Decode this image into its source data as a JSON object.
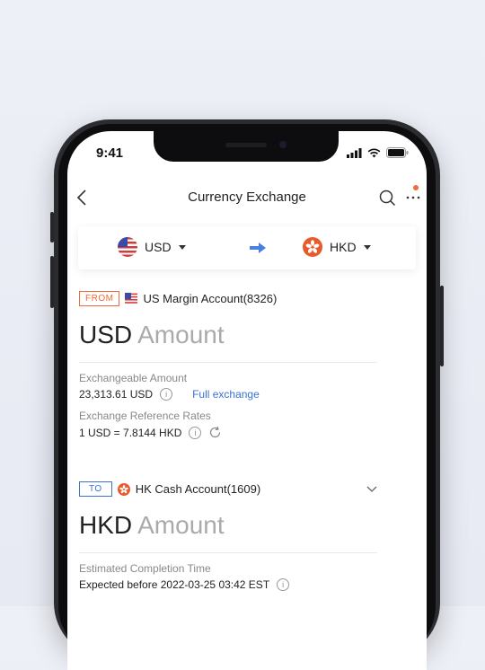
{
  "status": {
    "time": "9:41"
  },
  "nav": {
    "title": "Currency Exchange"
  },
  "pair": {
    "from_currency": "USD",
    "to_currency": "HKD"
  },
  "from": {
    "tag": "FROM",
    "account": "US Margin Account(8326)",
    "currency": "USD",
    "amount_placeholder": "Amount",
    "exchangeable_label": "Exchangeable Amount",
    "exchangeable_value": "23,313.61 USD",
    "full_exchange": "Full exchange",
    "rate_label": "Exchange Reference Rates",
    "rate_value": "1 USD = 7.8144 HKD"
  },
  "to": {
    "tag": "TO",
    "account": "HK Cash Account(1609)",
    "currency": "HKD",
    "amount_placeholder": "Amount",
    "completion_label": "Estimated Completion Time",
    "completion_value": "Expected before 2022-03-25 03:42 EST"
  },
  "colors": {
    "accent_orange": "#f06a3a",
    "link_blue": "#3a71d4",
    "arrow_blue": "#4a7fe0",
    "to_tag_blue": "#3a71d4"
  },
  "icons": [
    "back-icon",
    "search-icon",
    "more-icon",
    "us-flag-icon",
    "hk-flag-icon",
    "right-arrow-icon",
    "info-icon",
    "refresh-icon",
    "chevron-down-icon"
  ]
}
